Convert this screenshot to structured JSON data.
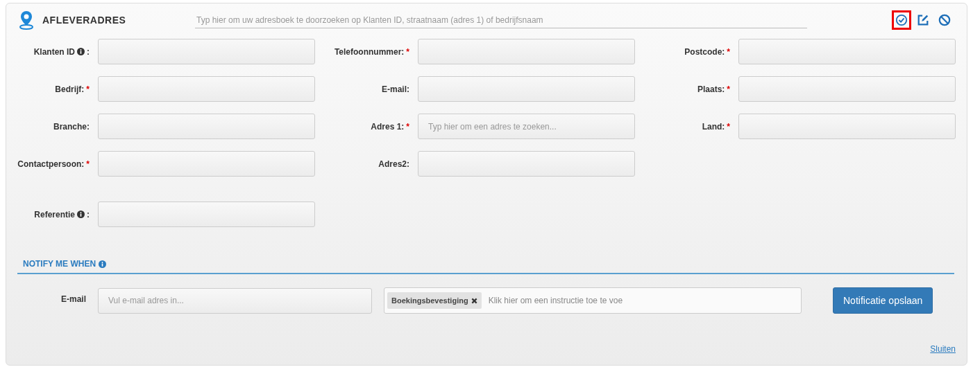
{
  "header": {
    "title": "AFLEVERADRES",
    "search_placeholder": "Typ hier om uw adresboek te doorzoeken op Klanten ID, straatnaam (adres 1) of bedrijfsnaam",
    "actions": [
      {
        "kind": "confirm",
        "highlighted": true
      },
      {
        "kind": "edit",
        "highlighted": false
      },
      {
        "kind": "cancel",
        "highlighted": false
      }
    ]
  },
  "rows": [
    {
      "fields": [
        {
          "label": "Klanten ID",
          "info": true,
          "suffix": ":"
        },
        {
          "label": "Telefoonnummer:",
          "marker": "*"
        },
        {
          "label": "Postcode:",
          "marker": "*"
        }
      ]
    },
    {
      "fields": [
        {
          "label": "Bedrijf:",
          "marker": "*"
        },
        {
          "label": "E-mail:"
        },
        {
          "label": "Plaats:",
          "marker": "*"
        }
      ]
    },
    {
      "fields": [
        {
          "label": "Branche:"
        },
        {
          "label": "Adres 1:",
          "marker": "*",
          "placeholder": "Typ hier om een adres te zoeken..."
        },
        {
          "label": "Land:",
          "marker": "*"
        }
      ]
    },
    {
      "fields": [
        {
          "label": "Contactpersoon:",
          "marker": "*"
        },
        {
          "label": "Adres2:"
        }
      ]
    }
  ],
  "reference": {
    "label": "Referentie",
    "info": true,
    "suffix": ":"
  },
  "notify": {
    "title": "NOTIFY ME WHEN",
    "info": true,
    "email_label": "E-mail",
    "email_placeholder": "Vul e-mail adres in...",
    "tags": [
      "Boekingsbevestiging"
    ],
    "instruction_placeholder": "Klik hier om een instructie toe te voe",
    "save_button": "Notificatie opslaan"
  },
  "close_link": "Sluiten"
}
